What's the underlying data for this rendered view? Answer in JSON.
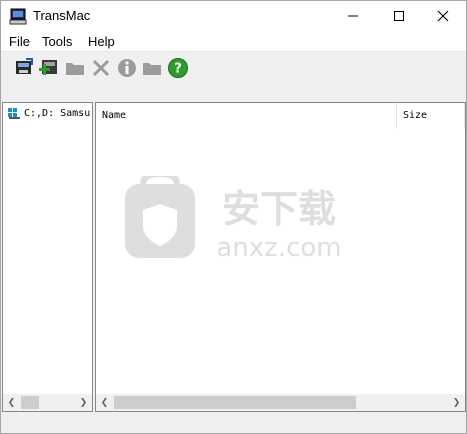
{
  "window": {
    "title": "TransMac",
    "icon": "transmac-app-icon",
    "controls": {
      "minimize": "minimize-icon",
      "maximize": "maximize-icon",
      "close": "close-icon"
    }
  },
  "menubar": {
    "items": [
      "File",
      "Tools",
      "Help"
    ]
  },
  "toolbar": {
    "buttons": [
      {
        "name": "open-disk-icon",
        "enabled": true
      },
      {
        "name": "new-disk-icon",
        "enabled": true
      },
      {
        "name": "folder-icon",
        "enabled": false
      },
      {
        "name": "delete-icon",
        "enabled": false
      },
      {
        "name": "info-icon",
        "enabled": false
      },
      {
        "name": "folder-icon",
        "enabled": false
      },
      {
        "name": "help-icon",
        "enabled": true
      }
    ]
  },
  "tree": {
    "items": [
      {
        "label": "C:,D: Samsu",
        "icon": "drive-icon"
      }
    ]
  },
  "file_list": {
    "columns": [
      "Name",
      "Size"
    ],
    "rows": []
  },
  "watermark": {
    "text_cn": "安下载",
    "text_en": "anxz.com"
  },
  "colors": {
    "accent_green": "#2e9b2e",
    "disabled_gray": "#9c9c9c"
  }
}
